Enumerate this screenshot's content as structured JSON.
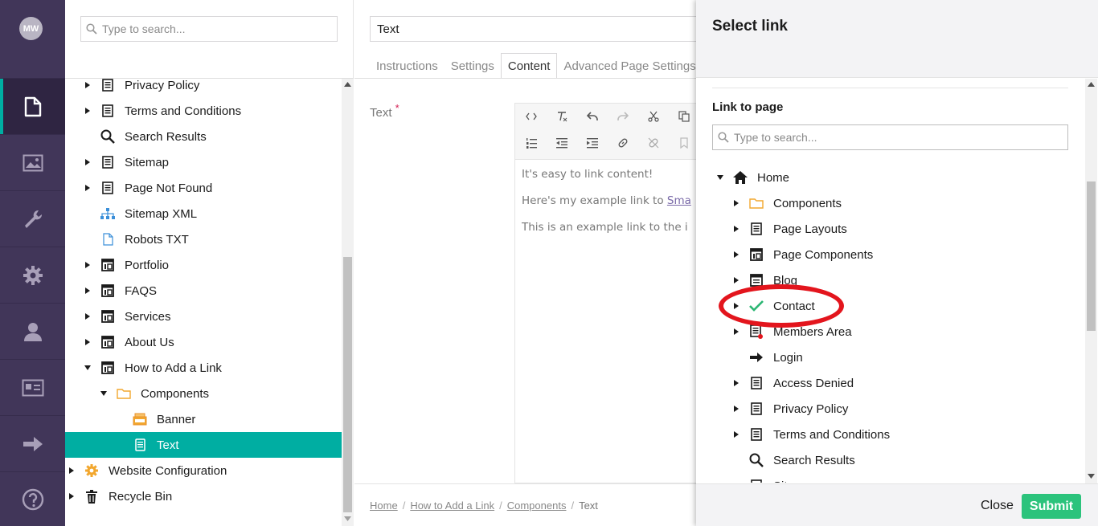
{
  "nav": {
    "avatar_initials": "MW",
    "sections": [
      {
        "name": "content",
        "icon": "document-icon",
        "active": true
      },
      {
        "name": "media",
        "icon": "image-icon",
        "active": false
      },
      {
        "name": "settings-tools",
        "icon": "wrench-icon",
        "active": false
      },
      {
        "name": "settings",
        "icon": "gear-icon",
        "active": false
      },
      {
        "name": "users",
        "icon": "user-icon",
        "active": false
      },
      {
        "name": "members",
        "icon": "id-card-icon",
        "active": false
      },
      {
        "name": "forms",
        "icon": "arrow-right-icon",
        "active": false
      },
      {
        "name": "help",
        "icon": "help-icon",
        "active": false
      }
    ]
  },
  "tree": {
    "search_placeholder": "Type to search...",
    "items": [
      {
        "label": "Privacy Policy",
        "icon": "page-icon",
        "caret": "right",
        "depth": 0
      },
      {
        "label": "Terms and Conditions",
        "icon": "page-icon",
        "caret": "right",
        "depth": 0
      },
      {
        "label": "Search Results",
        "icon": "search-icon",
        "caret": "none",
        "depth": 0
      },
      {
        "label": "Sitemap",
        "icon": "page-icon",
        "caret": "right",
        "depth": 0
      },
      {
        "label": "Page Not Found",
        "icon": "page-icon",
        "caret": "right",
        "depth": 0
      },
      {
        "label": "Sitemap XML",
        "icon": "sitemap-icon",
        "caret": "none",
        "depth": 0
      },
      {
        "label": "Robots TXT",
        "icon": "file-icon",
        "caret": "none",
        "depth": 0
      },
      {
        "label": "Portfolio",
        "icon": "layout-icon",
        "caret": "right",
        "depth": 0
      },
      {
        "label": "FAQS",
        "icon": "layout-icon",
        "caret": "right",
        "depth": 0
      },
      {
        "label": "Services",
        "icon": "layout-icon",
        "caret": "right",
        "depth": 0
      },
      {
        "label": "About Us",
        "icon": "layout-icon",
        "caret": "right",
        "depth": 0
      },
      {
        "label": "How to Add a Link",
        "icon": "layout-icon",
        "caret": "down",
        "depth": 0
      },
      {
        "label": "Components",
        "icon": "folder-icon",
        "caret": "down",
        "depth": 1
      },
      {
        "label": "Banner",
        "icon": "banner-icon",
        "caret": "none",
        "depth": 2
      },
      {
        "label": "Text",
        "icon": "text-doc-icon",
        "caret": "none",
        "depth": 2,
        "selected": true
      },
      {
        "label": "Website Configuration",
        "icon": "config-gear-icon",
        "caret": "right",
        "depth": -1
      },
      {
        "label": "Recycle Bin",
        "icon": "trash-icon",
        "caret": "right",
        "depth": -1
      }
    ]
  },
  "editor": {
    "node_name": "Text",
    "tabs": [
      {
        "label": "Instructions",
        "active": false
      },
      {
        "label": "Settings",
        "active": false
      },
      {
        "label": "Content",
        "active": true
      },
      {
        "label": "Advanced Page Settings",
        "active": false
      }
    ],
    "property_label": "Text",
    "required_mark": "*",
    "rte_paragraphs": [
      {
        "text": "It's easy to link content!",
        "link": ""
      },
      {
        "text": "Here's my example link to ",
        "link": "Sma"
      },
      {
        "text": "This is an example link to the i",
        "link": ""
      }
    ],
    "breadcrumb": [
      "Home",
      "How to Add a Link",
      "Components",
      "Text"
    ],
    "breadcrumb_divider": "/"
  },
  "dialog": {
    "title": "Select link",
    "section_label": "Link to page",
    "search_placeholder": "Type to search...",
    "items": [
      {
        "label": "Home",
        "icon": "home-icon",
        "caret": "down",
        "depth": 0
      },
      {
        "label": "Components",
        "icon": "folder-icon",
        "caret": "right",
        "depth": 1
      },
      {
        "label": "Page Layouts",
        "icon": "page-icon",
        "caret": "right",
        "depth": 1
      },
      {
        "label": "Page Components",
        "icon": "layout-icon",
        "caret": "right",
        "depth": 1
      },
      {
        "label": "Blog",
        "icon": "blog-icon",
        "caret": "right",
        "depth": 1
      },
      {
        "label": "Contact",
        "icon": "check-icon",
        "caret": "right",
        "depth": 1
      },
      {
        "label": "Members Area",
        "icon": "page-lock-icon",
        "caret": "right",
        "depth": 1
      },
      {
        "label": "Login",
        "icon": "arrow-right-icon",
        "caret": "none",
        "depth": 1
      },
      {
        "label": "Access Denied",
        "icon": "page-icon",
        "caret": "right",
        "depth": 1
      },
      {
        "label": "Privacy Policy",
        "icon": "page-icon",
        "caret": "right",
        "depth": 1
      },
      {
        "label": "Terms and Conditions",
        "icon": "page-icon",
        "caret": "right",
        "depth": 1
      },
      {
        "label": "Search Results",
        "icon": "search-icon",
        "caret": "none",
        "depth": 1
      },
      {
        "label": "Sitemap",
        "icon": "page-icon",
        "caret": "right",
        "depth": 1
      }
    ],
    "close_label": "Close",
    "submit_label": "Submit"
  },
  "colors": {
    "nav_bg": "#413659",
    "accent": "#00aea2",
    "submit": "#2bc37c",
    "annotation": "#e3151d"
  }
}
